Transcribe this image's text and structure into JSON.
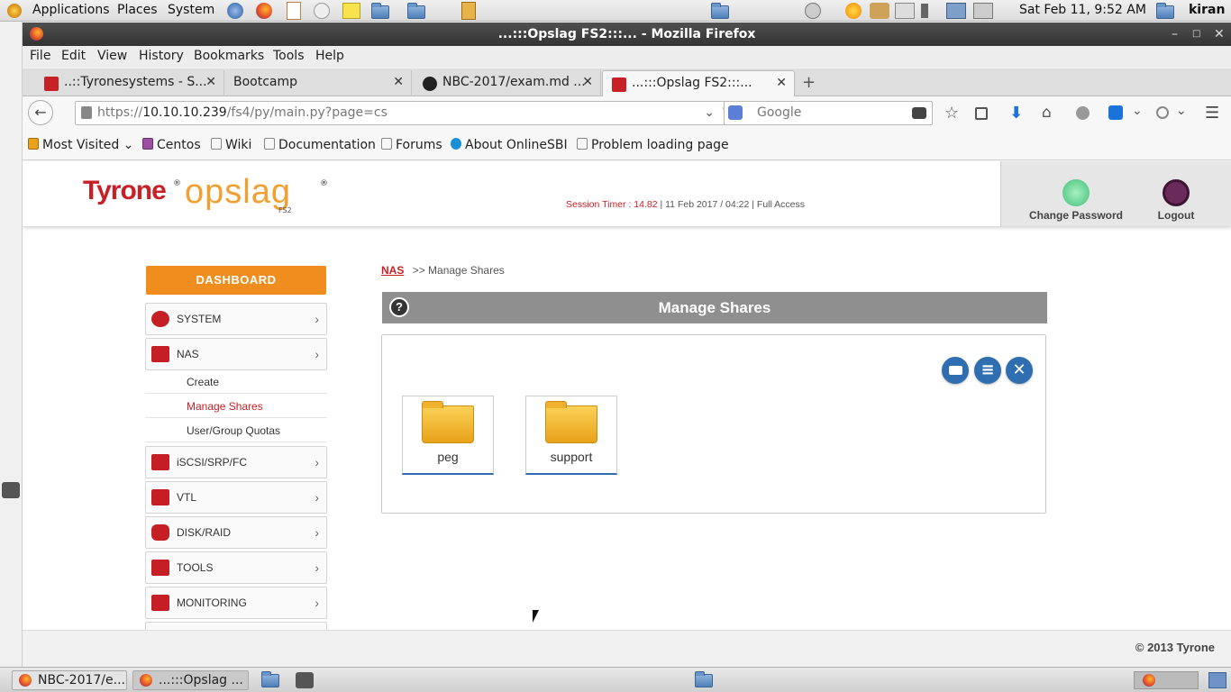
{
  "gnome_panel": {
    "menus": [
      "Applications",
      "Places",
      "System"
    ],
    "datetime": "Sat Feb 11,  9:52 AM",
    "user": "kiran"
  },
  "window": {
    "title": "...:::Opslag FS2:::... - Mozilla Firefox"
  },
  "menubar": [
    "File",
    "Edit",
    "View",
    "History",
    "Bookmarks",
    "Tools",
    "Help"
  ],
  "tabs": [
    {
      "label": "..::Tyronesystems - S...",
      "favicon_color": "#c82027"
    },
    {
      "label": "Bootcamp",
      "favicon_color": ""
    },
    {
      "label": "NBC-2017/exam.md ...",
      "favicon_color": "#222222"
    },
    {
      "label": "...:::Opslag FS2:::...",
      "favicon_color": "#c82027"
    }
  ],
  "url": {
    "prefix": "https://",
    "host": "10.10.10.239",
    "path": "/fs4/py/main.py?page=cs"
  },
  "search": {
    "placeholder": "Google"
  },
  "bookmarks": [
    "Most Visited",
    "Centos",
    "Wiki",
    "Documentation",
    "Forums",
    "About OnlineSBI",
    "Problem loading page"
  ],
  "header": {
    "logo_brand": "Tyrone",
    "logo_product": "opslag",
    "logo_model": "FS2",
    "session_label": "Session Timer : 14.82",
    "session_date": " | 11 Feb 2017 / 04:22 | Full Access",
    "change_password": "Change Password",
    "logout": "Logout"
  },
  "sidebar": {
    "dashboard": "DASHBOARD",
    "items": [
      {
        "label": "SYSTEM"
      },
      {
        "label": "NAS"
      },
      {
        "label": "iSCSI/SRP/FC"
      },
      {
        "label": "VTL"
      },
      {
        "label": "DISK/RAID"
      },
      {
        "label": "TOOLS"
      },
      {
        "label": "MONITORING"
      }
    ],
    "nas_sub": [
      "Create",
      "Manage Shares",
      "User/Group Quotas"
    ]
  },
  "breadcrumb": {
    "root": "NAS",
    "current": ">> Manage Shares"
  },
  "main": {
    "title": "Manage Shares",
    "help_icon": "?",
    "shares": [
      {
        "name": "peg"
      },
      {
        "name": "support"
      }
    ]
  },
  "footer": {
    "copyright": "© 2013 Tyrone"
  },
  "taskbar": [
    {
      "label": "NBC-2017/e..."
    },
    {
      "label": "...:::Opslag ..."
    }
  ],
  "colors": {
    "brand_red": "#c82027",
    "brand_orange": "#ef8e1e",
    "accent_blue": "#2f6fb1"
  }
}
